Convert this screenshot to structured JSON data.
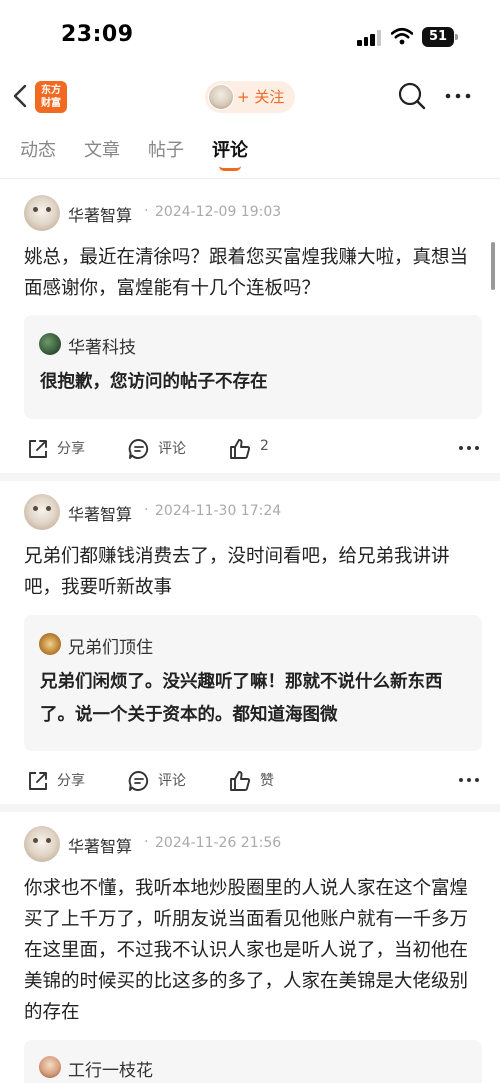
{
  "status_bar": {
    "time": "23:09",
    "battery": "51"
  },
  "nav": {
    "logo_line1": "东方",
    "logo_line2": "财富",
    "follow_label": "+ 关注"
  },
  "tabs": [
    {
      "label": "动态"
    },
    {
      "label": "文章"
    },
    {
      "label": "帖子"
    },
    {
      "label": "评论"
    }
  ],
  "active_tab": "评论",
  "posts": [
    {
      "author": "华著智算",
      "time": "2024-12-09 19:03",
      "text": "姚总，最近在清徐吗？跟着您买富煌我赚大啦，真想当面感谢你，富煌能有十几个连板吗？",
      "quote_author": "华著科技",
      "quote_text": "很抱歉，您访问的帖子不存在",
      "share": "分享",
      "comment": "评论",
      "like": "2"
    },
    {
      "author": "华著智算",
      "time": "2024-11-30 17:24",
      "text": "兄弟们都赚钱消费去了，没时间看吧，给兄弟我讲讲吧，我要听新故事",
      "quote_author": "兄弟们顶住",
      "quote_text": "兄弟们闲烦了。没兴趣听了嘛！那就不说什么新东西了。说一个关于资本的。都知道海图微",
      "share": "分享",
      "comment": "评论",
      "like": "赞"
    },
    {
      "author": "华著智算",
      "time": "2024-11-26 21:56",
      "text": "你求也不懂，我听本地炒股圈里的人说人家在这个富煌买了上千万了，听朋友说当面看见他账户就有一千多万在这里面，不过我不认识人家也是听人说了，当初他在美锦的时候买的比这多的多了，人家在美锦是大佬级别的存在",
      "quote_author": "工行一枝花"
    }
  ],
  "colors": {
    "accent": "#f06b21",
    "quote_bg": "#f6f6f6"
  }
}
